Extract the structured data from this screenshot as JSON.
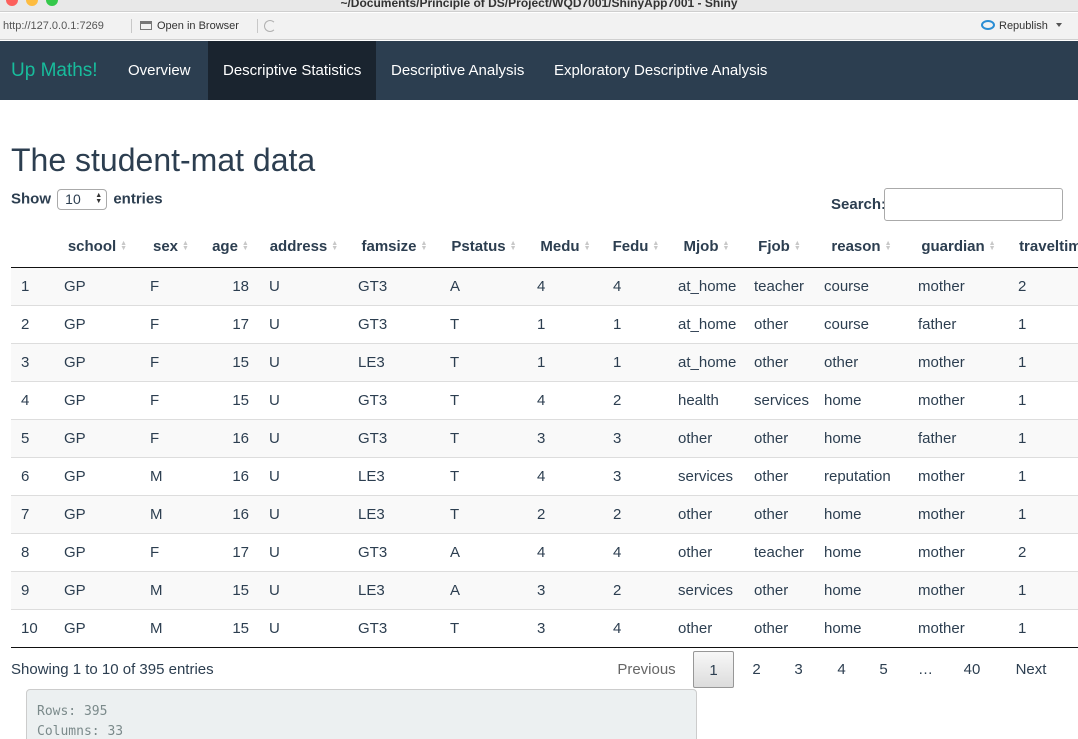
{
  "window": {
    "title": "~/Documents/Principle of DS/Project/WQD7001/ShinyApp7001 - Shiny"
  },
  "viewer_toolbar": {
    "url": "http://127.0.0.1:7269",
    "open_browser_label": "Open in Browser",
    "republish_label": "Republish"
  },
  "navbar": {
    "brand": "Up Maths!",
    "tabs": [
      {
        "label": "Overview",
        "active": false
      },
      {
        "label": "Descriptive Statistics",
        "active": true
      },
      {
        "label": "Descriptive Analysis",
        "active": false
      },
      {
        "label": "Exploratory Descriptive Analysis",
        "active": false
      }
    ]
  },
  "main": {
    "title": "The student-mat data",
    "length": {
      "prefix": "Show",
      "value": "10",
      "suffix": "entries"
    },
    "search": {
      "label": "Search:",
      "value": ""
    }
  },
  "table": {
    "columns": [
      "",
      "school",
      "sex",
      "age",
      "address",
      "famsize",
      "Pstatus",
      "Medu",
      "Fedu",
      "Mjob",
      "Fjob",
      "reason",
      "guardian",
      "traveltime"
    ],
    "rows": [
      [
        "1",
        "GP",
        "F",
        "18",
        "U",
        "GT3",
        "A",
        "4",
        "4",
        "at_home",
        "teacher",
        "course",
        "mother",
        "2"
      ],
      [
        "2",
        "GP",
        "F",
        "17",
        "U",
        "GT3",
        "T",
        "1",
        "1",
        "at_home",
        "other",
        "course",
        "father",
        "1"
      ],
      [
        "3",
        "GP",
        "F",
        "15",
        "U",
        "LE3",
        "T",
        "1",
        "1",
        "at_home",
        "other",
        "other",
        "mother",
        "1"
      ],
      [
        "4",
        "GP",
        "F",
        "15",
        "U",
        "GT3",
        "T",
        "4",
        "2",
        "health",
        "services",
        "home",
        "mother",
        "1"
      ],
      [
        "5",
        "GP",
        "F",
        "16",
        "U",
        "GT3",
        "T",
        "3",
        "3",
        "other",
        "other",
        "home",
        "father",
        "1"
      ],
      [
        "6",
        "GP",
        "M",
        "16",
        "U",
        "LE3",
        "T",
        "4",
        "3",
        "services",
        "other",
        "reputation",
        "mother",
        "1"
      ],
      [
        "7",
        "GP",
        "M",
        "16",
        "U",
        "LE3",
        "T",
        "2",
        "2",
        "other",
        "other",
        "home",
        "mother",
        "1"
      ],
      [
        "8",
        "GP",
        "F",
        "17",
        "U",
        "GT3",
        "A",
        "4",
        "4",
        "other",
        "teacher",
        "home",
        "mother",
        "2"
      ],
      [
        "9",
        "GP",
        "M",
        "15",
        "U",
        "LE3",
        "A",
        "3",
        "2",
        "services",
        "other",
        "home",
        "mother",
        "1"
      ],
      [
        "10",
        "GP",
        "M",
        "15",
        "U",
        "GT3",
        "T",
        "3",
        "4",
        "other",
        "other",
        "home",
        "mother",
        "1"
      ]
    ]
  },
  "info": "Showing 1 to 10 of 395 entries",
  "pagination": {
    "previous": "Previous",
    "pages": [
      "1",
      "2",
      "3",
      "4",
      "5",
      "…",
      "40"
    ],
    "current": "1",
    "next": "Next"
  },
  "verbatim": {
    "rows_line": "Rows: 395",
    "columns_line": "Columns: 33"
  }
}
